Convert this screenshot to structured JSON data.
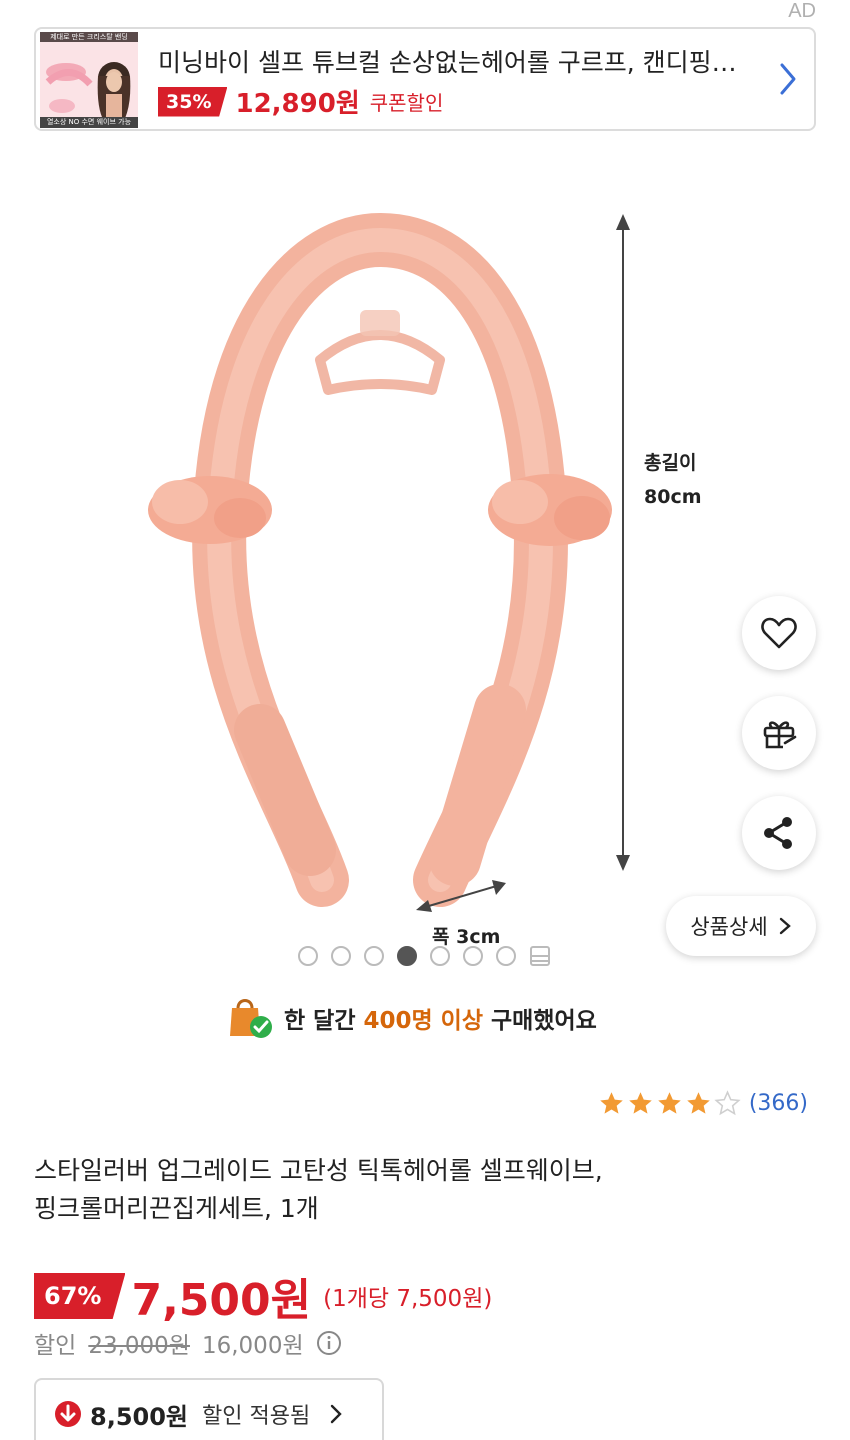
{
  "ad": {
    "label": "AD",
    "thumb_top_text": "제대로 만든 크리스탈 밴딩",
    "thumb_bottom_text": "열소상 NO 수면 웨이브 가능",
    "title": "미닝바이 셀프 튜브컬 손상없는헤어롤 구르프, 캔디핑…",
    "discount": "35%",
    "price": "12,890원",
    "coupon": "쿠폰할인"
  },
  "image": {
    "length_label": "총길이",
    "length_value": "80cm",
    "width_label": "폭 3cm"
  },
  "floating": {
    "detail_button": "상품상세"
  },
  "pager": {
    "total": 7,
    "active_index": 3
  },
  "notice": {
    "prefix": "한 달간",
    "highlight": "400명 이상",
    "suffix": "구매했어요"
  },
  "rating": {
    "stars": 4,
    "max": 5,
    "count": "(366)"
  },
  "product": {
    "title_line1": "스타일러버 업그레이드 고탄성 틱톡헤어롤 셀프웨이브,",
    "title_line2": "핑크롤머리끈집게세트, 1개"
  },
  "price": {
    "discount": "67%",
    "sale": "7,500원",
    "per_unit": "(1개당 7,500원)",
    "discount_label": "할인",
    "original": "23,000원",
    "discount_amount": "16,000원"
  },
  "applied": {
    "amount": "8,500원",
    "text": "할인 적용됨"
  },
  "colors": {
    "accent": "#d81f2a",
    "link": "#3469c8",
    "highlight": "#d5660a",
    "product_pink": "#f6b8a3"
  }
}
